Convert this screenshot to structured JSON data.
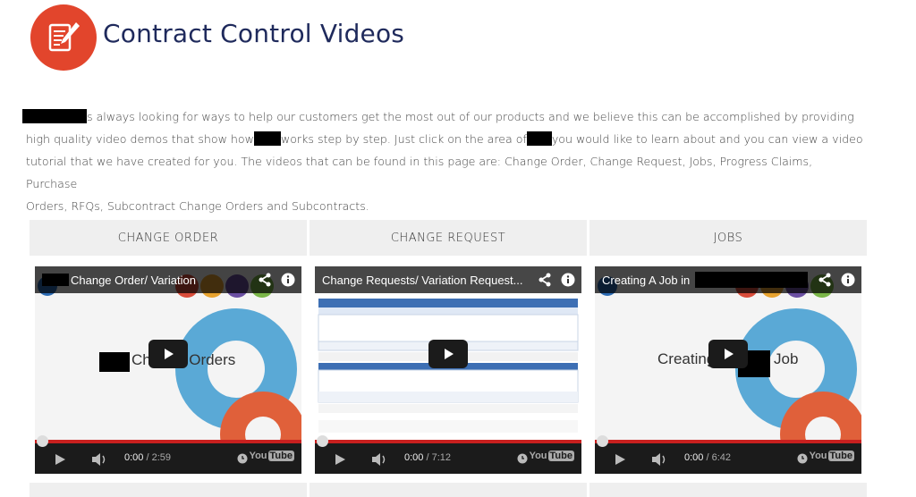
{
  "header": {
    "title": "Contract Control Videos"
  },
  "intro": {
    "p1": "s always looking for ways to help our customers get the most out of our products and we believe this can be accomplished by providing",
    "p2a": "high quality video demos that show how",
    "p2b": "works step by step.  Just click on the area of",
    "p2c": "you would like to learn about and you can view a video",
    "p3": "tutorial that we have created for you. The videos that can be found in this page are:  Change Order, Change Request, Jobs, Progress Claims, Purchase",
    "p4": "Orders, RFQs, Subcontract Change Orders and Subcontracts."
  },
  "cards": [
    {
      "heading": "CHANGE ORDER",
      "video_title": "Change Order/ Variation",
      "overlay_text": "Change Orders",
      "time": "0:00",
      "duration": "/ 2:59"
    },
    {
      "heading": "CHANGE REQUEST",
      "video_title": "Change Requests/ Variation Request...",
      "overlay_text": "",
      "time": "0:00",
      "duration": "/ 7:12"
    },
    {
      "heading": "JOBS",
      "video_title": "Creating A Job in",
      "overlay_text": "Creating",
      "overlay_text2": "Job",
      "time": "0:00",
      "duration": "/ 6:42"
    }
  ],
  "youtube_label": "You",
  "youtube_label2": "Tube",
  "colors": {
    "logo": "#e2452c",
    "title": "#1f2a5c",
    "progress": "#c8201f"
  }
}
